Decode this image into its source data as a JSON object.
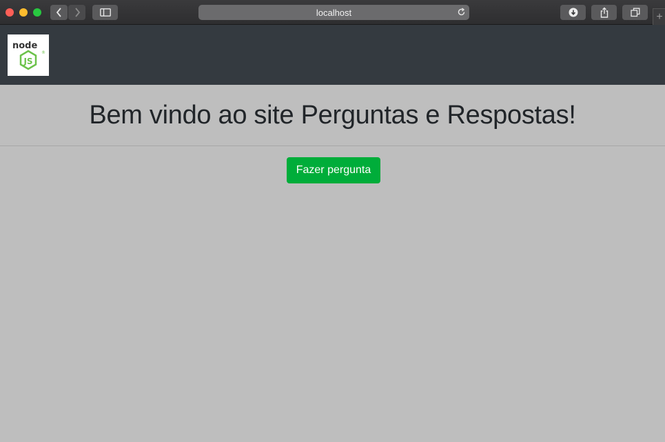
{
  "browser": {
    "url": "localhost",
    "new_tab_symbol": "+",
    "icons": [
      "back-icon",
      "forward-icon",
      "sidebar-icon",
      "reload-icon",
      "download-icon",
      "share-icon",
      "tabs-overview-icon"
    ]
  },
  "navbar": {
    "logo": {
      "word": "node",
      "badge": "JS",
      "mark": "®"
    },
    "colors": {
      "background": "#343a40"
    }
  },
  "main": {
    "heading": "Bem vindo ao site Perguntas e Respostas!",
    "ask_button_label": "Fazer pergunta",
    "colors": {
      "background": "#bebebe",
      "button": "#00ad3a",
      "heading": "#212529"
    }
  }
}
